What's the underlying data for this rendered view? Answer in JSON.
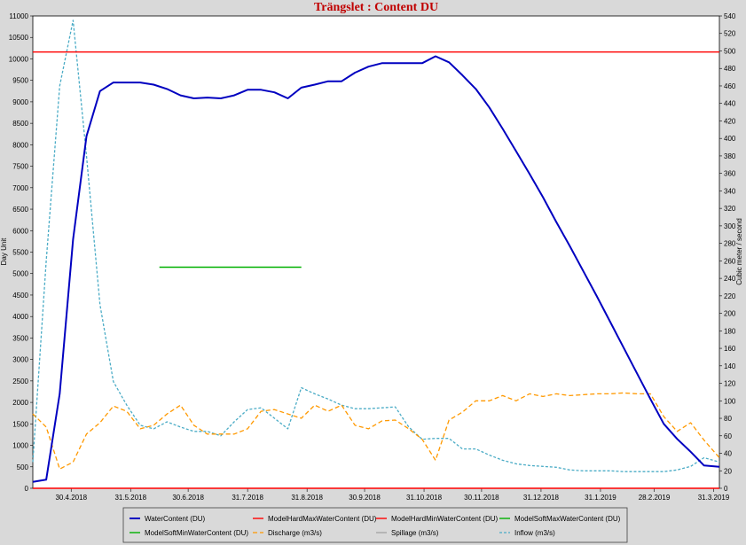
{
  "chart_data": {
    "type": "line",
    "title": "Trängslet : Content DU",
    "ylabel": "Day Unit",
    "y2label": "Cubic meter / second",
    "ylim": [
      0,
      11000
    ],
    "y2lim": [
      0,
      540
    ],
    "yticks": [
      "0",
      "500",
      "1000",
      "1500",
      "2000",
      "2500",
      "3000",
      "3500",
      "4000",
      "4500",
      "5000",
      "5500",
      "6000",
      "6500",
      "7000",
      "7500",
      "8000",
      "8500",
      "9000",
      "9500",
      "10000",
      "10500",
      "11000"
    ],
    "y2ticks": [
      "0",
      "20",
      "40",
      "60",
      "80",
      "100",
      "120",
      "140",
      "160",
      "180",
      "200",
      "220",
      "240",
      "260",
      "280",
      "300",
      "320",
      "340",
      "360",
      "380",
      "400",
      "420",
      "440",
      "460",
      "480",
      "500",
      "520",
      "540"
    ],
    "xlim": [
      "2018-04-10",
      "2019-04-03"
    ],
    "xticks": [
      {
        "date": "2018-04-30",
        "label": "30.4.2018"
      },
      {
        "date": "2018-05-31",
        "label": "31.5.2018"
      },
      {
        "date": "2018-06-30",
        "label": "30.6.2018"
      },
      {
        "date": "2018-07-31",
        "label": "31.7.2018"
      },
      {
        "date": "2018-08-31",
        "label": "31.8.2018"
      },
      {
        "date": "2018-09-30",
        "label": "30.9.2018"
      },
      {
        "date": "2018-10-31",
        "label": "31.10.2018"
      },
      {
        "date": "2018-11-30",
        "label": "30.11.2018"
      },
      {
        "date": "2018-12-31",
        "label": "31.12.2018"
      },
      {
        "date": "2019-01-31",
        "label": "31.1.2019"
      },
      {
        "date": "2019-02-28",
        "label": "28.2.2019"
      },
      {
        "date": "2019-03-31",
        "label": "31.3.2019"
      }
    ],
    "grid": false,
    "legend_position": "bottom",
    "series": [
      {
        "name": "WaterContent (DU)",
        "axis": "left",
        "color": "#0000c0",
        "style": "solid-thick",
        "x": [
          "2018-04-10",
          "2018-04-17",
          "2018-04-24",
          "2018-05-01",
          "2018-05-08",
          "2018-05-15",
          "2018-05-22",
          "2018-05-29",
          "2018-06-05",
          "2018-06-12",
          "2018-06-19",
          "2018-06-26",
          "2018-07-03",
          "2018-07-10",
          "2018-07-17",
          "2018-07-24",
          "2018-07-31",
          "2018-08-07",
          "2018-08-14",
          "2018-08-21",
          "2018-08-28",
          "2018-09-04",
          "2018-09-11",
          "2018-09-18",
          "2018-09-25",
          "2018-10-02",
          "2018-10-09",
          "2018-10-16",
          "2018-10-23",
          "2018-10-30",
          "2018-11-06",
          "2018-11-13",
          "2018-11-20",
          "2018-11-27",
          "2018-12-04",
          "2018-12-11",
          "2018-12-18",
          "2018-12-25",
          "2019-01-01",
          "2019-01-08",
          "2019-01-15",
          "2019-01-22",
          "2019-01-29",
          "2019-02-05",
          "2019-02-12",
          "2019-02-19",
          "2019-02-26",
          "2019-03-05",
          "2019-03-12",
          "2019-03-19",
          "2019-03-26",
          "2019-04-03"
        ],
        "values": [
          150,
          200,
          2200,
          5800,
          8200,
          9250,
          9450,
          9450,
          9450,
          9400,
          9300,
          9150,
          9080,
          9100,
          9080,
          9150,
          9280,
          9280,
          9220,
          9080,
          9330,
          9400,
          9480,
          9480,
          9680,
          9820,
          9900,
          9900,
          9900,
          9900,
          10060,
          9920,
          9620,
          9300,
          8870,
          8370,
          7850,
          7320,
          6780,
          6200,
          5640,
          5060,
          4480,
          3880,
          3280,
          2680,
          2080,
          1500,
          1150,
          850,
          530,
          500
        ]
      },
      {
        "name": "ModelHardMaxWaterContent (DU)",
        "axis": "left",
        "color": "#ff0000",
        "style": "solid",
        "x": [
          "2018-04-10",
          "2019-04-03"
        ],
        "values": [
          10160,
          10160
        ]
      },
      {
        "name": "ModelHardMinWaterContent (DU)",
        "axis": "left",
        "color": "#ff0000",
        "style": "solid",
        "x": [
          "2018-04-10",
          "2019-04-03"
        ],
        "values": [
          0,
          0
        ]
      },
      {
        "name": "ModelSoftMaxWaterContent (DU)",
        "axis": "left",
        "color": "#00b000",
        "style": "solid",
        "x": [],
        "values": []
      },
      {
        "name": "ModelSoftMinWaterContent (DU)",
        "axis": "left",
        "color": "#00b000",
        "style": "solid",
        "x": [
          "2018-06-15",
          "2018-08-28"
        ],
        "values": [
          5150,
          5150
        ]
      },
      {
        "name": "Discharge (m3/s)",
        "axis": "right",
        "color": "#ff9900",
        "style": "dashed",
        "x": [
          "2018-04-10",
          "2018-04-17",
          "2018-04-24",
          "2018-05-01",
          "2018-05-08",
          "2018-05-15",
          "2018-05-22",
          "2018-05-29",
          "2018-06-05",
          "2018-06-12",
          "2018-06-19",
          "2018-06-26",
          "2018-07-03",
          "2018-07-10",
          "2018-07-17",
          "2018-07-24",
          "2018-07-31",
          "2018-08-07",
          "2018-08-14",
          "2018-08-21",
          "2018-08-28",
          "2018-09-04",
          "2018-09-11",
          "2018-09-18",
          "2018-09-25",
          "2018-10-02",
          "2018-10-09",
          "2018-10-16",
          "2018-10-23",
          "2018-10-30",
          "2018-11-06",
          "2018-11-13",
          "2018-11-20",
          "2018-11-27",
          "2018-12-04",
          "2018-12-11",
          "2018-12-18",
          "2018-12-25",
          "2019-01-01",
          "2019-01-08",
          "2019-01-15",
          "2019-01-22",
          "2019-01-29",
          "2019-02-05",
          "2019-02-12",
          "2019-02-19",
          "2019-02-26",
          "2019-03-05",
          "2019-03-12",
          "2019-03-19",
          "2019-03-26",
          "2019-04-03"
        ],
        "values": [
          85,
          70,
          22,
          30,
          62,
          75,
          94,
          88,
          68,
          72,
          85,
          95,
          72,
          62,
          62,
          62,
          68,
          88,
          90,
          85,
          80,
          95,
          88,
          95,
          72,
          68,
          77,
          78,
          68,
          56,
          32,
          78,
          87,
          100,
          100,
          106,
          100,
          108,
          105,
          108,
          106,
          107,
          108,
          108,
          109,
          108,
          108,
          82,
          65,
          75,
          55,
          35
        ]
      },
      {
        "name": "Spillage (m3/s)",
        "axis": "right",
        "color": "#a6a6a6",
        "style": "solid",
        "x": [],
        "values": []
      },
      {
        "name": "Inflow (m3/s)",
        "axis": "right",
        "color": "#4bacc6",
        "style": "dashed",
        "x": [
          "2018-04-10",
          "2018-04-17",
          "2018-04-24",
          "2018-05-01",
          "2018-05-08",
          "2018-05-15",
          "2018-05-22",
          "2018-05-29",
          "2018-06-05",
          "2018-06-12",
          "2018-06-19",
          "2018-06-26",
          "2018-07-03",
          "2018-07-10",
          "2018-07-17",
          "2018-07-24",
          "2018-07-31",
          "2018-08-07",
          "2018-08-14",
          "2018-08-21",
          "2018-08-28",
          "2018-09-04",
          "2018-09-11",
          "2018-09-18",
          "2018-09-25",
          "2018-10-02",
          "2018-10-09",
          "2018-10-16",
          "2018-10-23",
          "2018-10-30",
          "2018-11-06",
          "2018-11-13",
          "2018-11-20",
          "2018-11-27",
          "2018-12-04",
          "2018-12-11",
          "2018-12-18",
          "2018-12-25",
          "2019-01-01",
          "2019-01-08",
          "2019-01-15",
          "2019-01-22",
          "2019-01-29",
          "2019-02-05",
          "2019-02-12",
          "2019-02-19",
          "2019-02-26",
          "2019-03-05",
          "2019-03-12",
          "2019-03-19",
          "2019-03-26",
          "2019-04-03"
        ],
        "values": [
          30,
          260,
          460,
          535,
          380,
          210,
          122,
          95,
          72,
          68,
          76,
          70,
          65,
          65,
          60,
          76,
          90,
          92,
          80,
          68,
          115,
          108,
          102,
          95,
          91,
          91,
          92,
          93,
          70,
          56,
          57,
          57,
          45,
          45,
          38,
          32,
          28,
          26,
          25,
          24,
          21,
          20,
          20,
          20,
          19,
          19,
          19,
          19,
          21,
          25,
          35,
          30
        ]
      }
    ]
  }
}
